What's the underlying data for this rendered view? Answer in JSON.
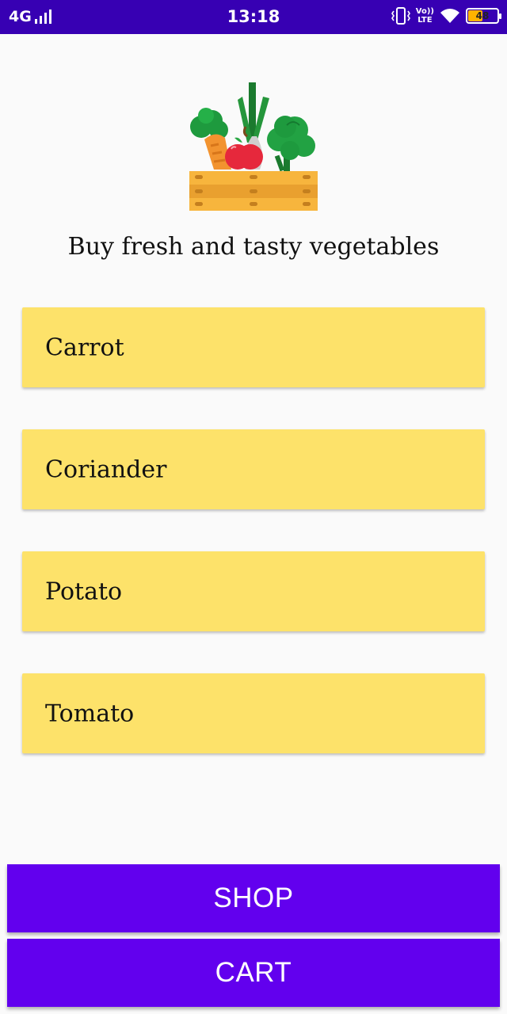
{
  "status_bar": {
    "network": "4G",
    "time": "13:18",
    "volte_top": "Vo))",
    "volte_bottom": "LTE",
    "battery_level": "48",
    "battery_fraction": 0.48,
    "icons": [
      "signal-icon",
      "vibrate-icon",
      "volte-icon",
      "wifi-icon",
      "battery-icon"
    ]
  },
  "header": {
    "logo_icon": "vegetable-basket-icon",
    "tagline": "Buy fresh and tasty vegetables"
  },
  "items": [
    {
      "label": "Carrot"
    },
    {
      "label": "Coriander"
    },
    {
      "label": "Potato"
    },
    {
      "label": "Tomato"
    }
  ],
  "buttons": {
    "shop_label": "SHOP",
    "cart_label": "CART"
  },
  "colors": {
    "status_bar": "#3700b3",
    "primary": "#6200ee",
    "card": "#fde26a",
    "background": "#fafafa"
  }
}
